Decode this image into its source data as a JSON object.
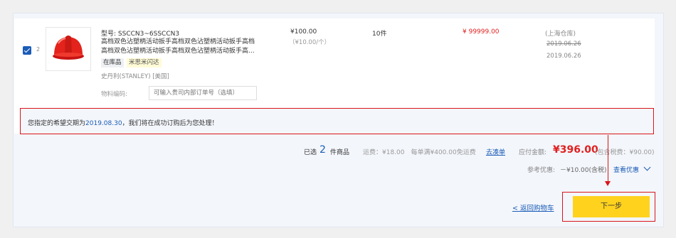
{
  "item": {
    "index": "2",
    "model": "型号: SSCCN3~6SSCCN3",
    "description_lines": [
      "高档双色沾塑柄活动扳手高档双色沾塑柄活动扳手高档",
      "高档双色沾塑柄活动扳手高档双色沾塑柄活动扳手高..."
    ],
    "tag_stock": "在库品",
    "tag_flash": "米思米闪达",
    "brand": "史丹利(STANLEY) [美国]",
    "code_label": "物料编码:",
    "code_placeholder": "可输入贵司内部订单号（选填）",
    "price": "¥100.00",
    "unit_price": "（¥10.00/个）",
    "quantity": "10件",
    "subtotal": "¥ 99999.00",
    "warehouse": "(上海仓库)",
    "date_original": "2019.06.26",
    "date_current": "2019.06.26",
    "image_icon": "red-safety-helmet"
  },
  "notice": {
    "prefix": "您指定的希望交期为",
    "date": "2019.08.30",
    "suffix": "，我们将在成功订购后为您处理！"
  },
  "summary": {
    "selected_label": "已选",
    "selected_count": "2",
    "selected_unit": "件商品",
    "shipping": "运费：¥18.00　每单满¥400.00免运费",
    "promo_link": "去凑单",
    "due_label": "应付金额:",
    "due_amount": "¥396.00",
    "tax_note": "(包含税费：¥90.00)",
    "reference_label": "参考优惠:",
    "reference_value": "－¥10.00(含税)",
    "detail_link": "查看优惠"
  },
  "actions": {
    "back_label": "< 返回购物车",
    "next_label": "下一步"
  },
  "colors": {
    "accent_blue": "#1b5cb7",
    "price_red": "#e02020",
    "highlight_red": "#d9151b",
    "button_yellow": "#ffd21e"
  }
}
